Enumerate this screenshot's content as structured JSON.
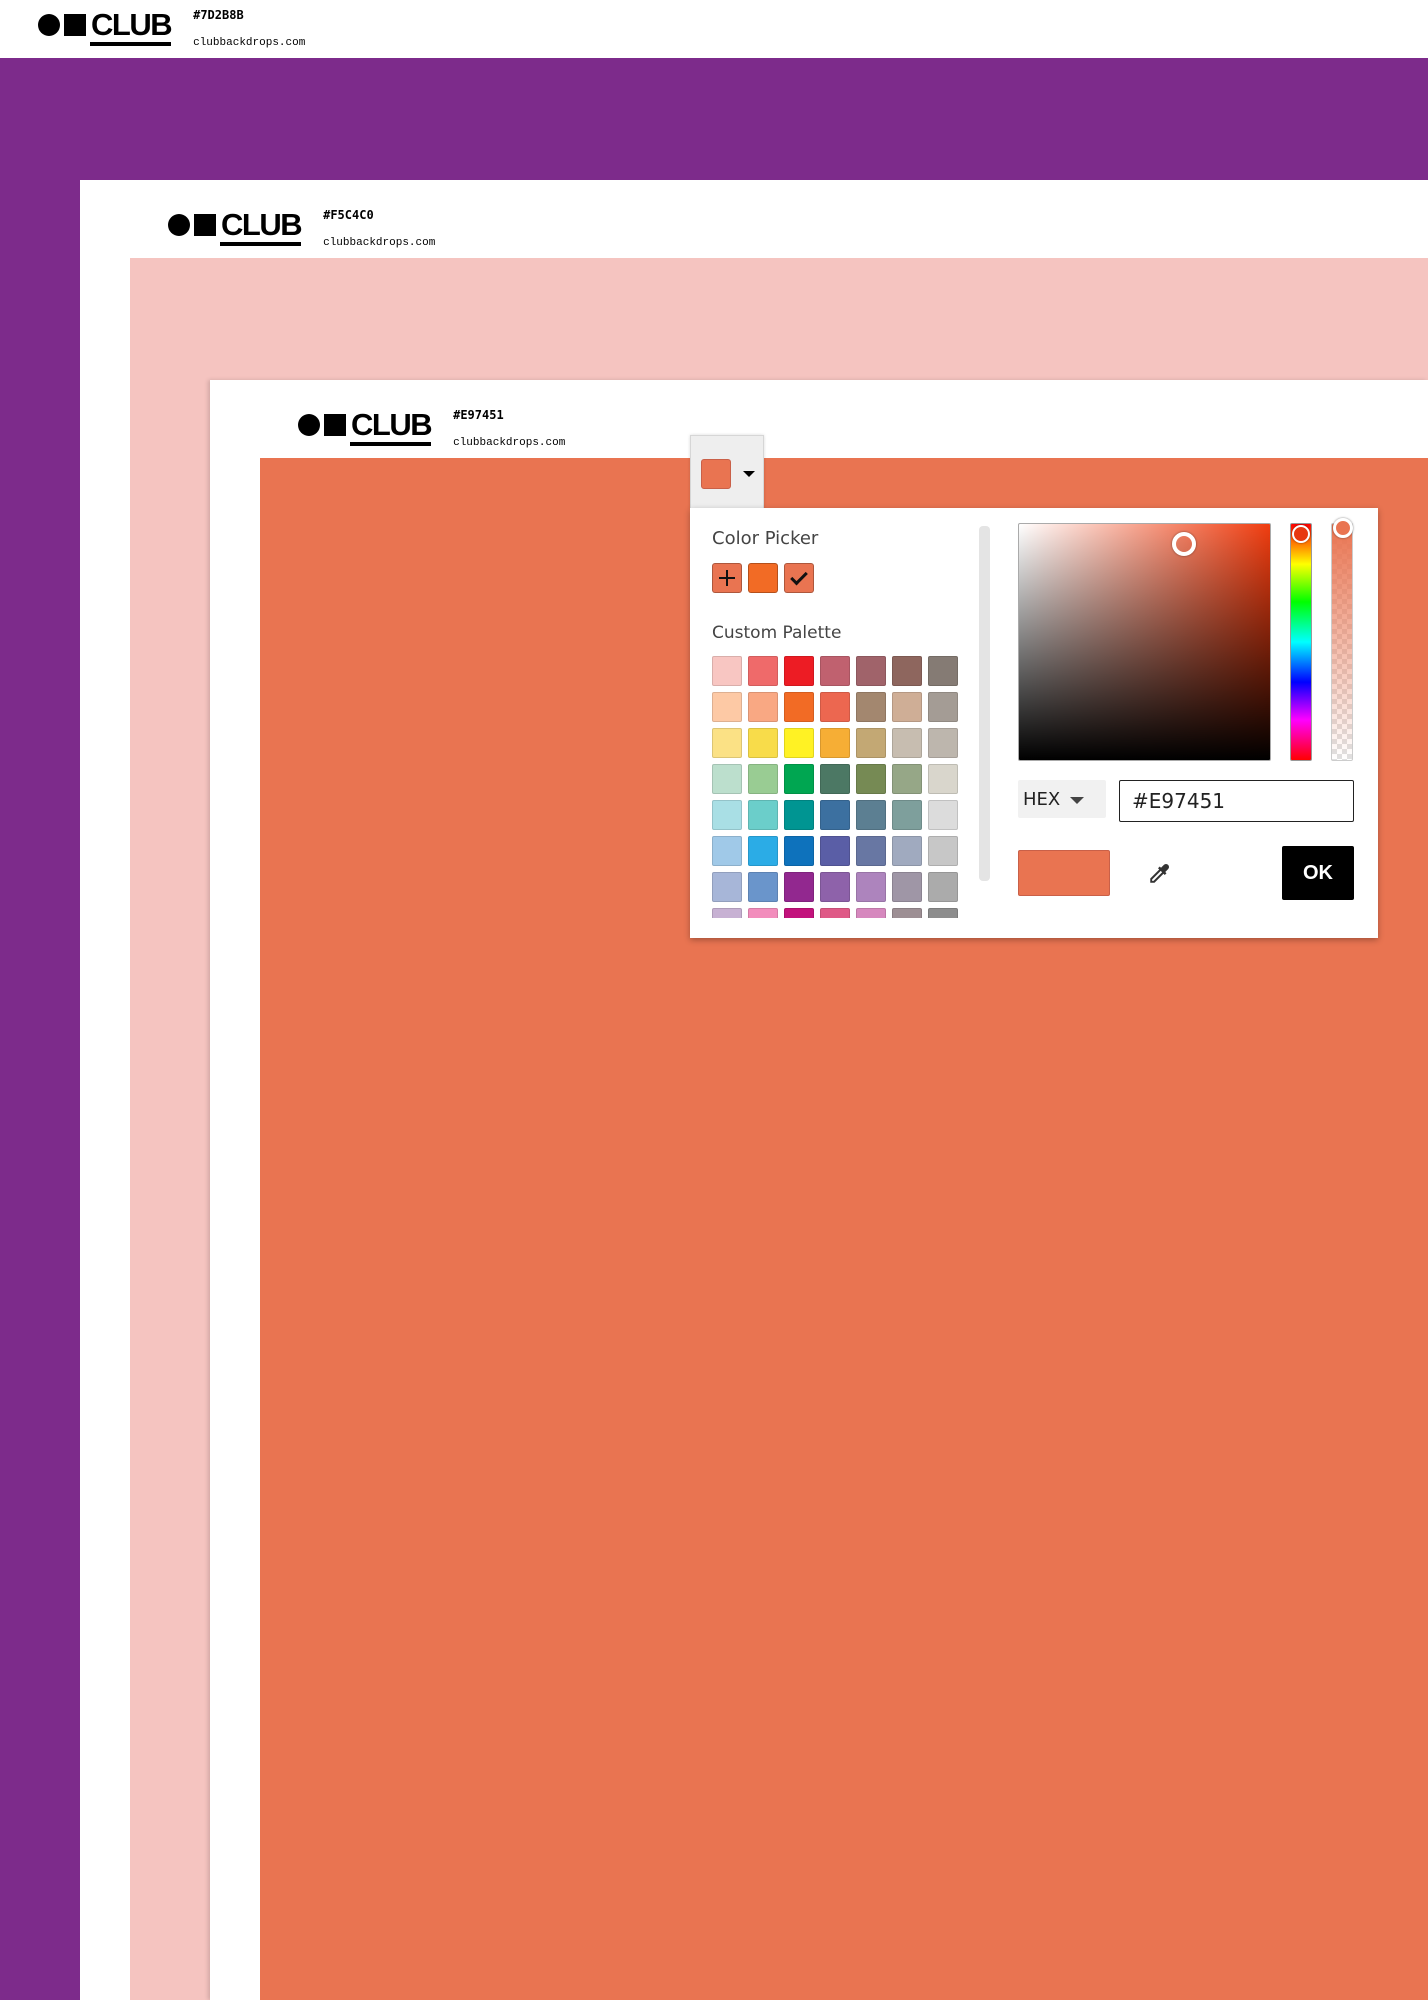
{
  "layers": [
    {
      "hex": "#7D2B8B",
      "url": "clubbackdrops.com",
      "logo": "CLUB"
    },
    {
      "hex": "#F5C4C0",
      "url": "clubbackdrops.com",
      "logo": "CLUB"
    },
    {
      "hex": "#E97451",
      "url": "clubbackdrops.com",
      "logo": "CLUB"
    }
  ],
  "colors": {
    "outer": "#7D2B8B",
    "middle": "#F5C4C0",
    "inner": "#E97451",
    "selected": "#E97451",
    "recent_orange": "#F26B25"
  },
  "picker": {
    "title": "Color Picker",
    "palette_title": "Custom Palette",
    "mode_label": "HEX",
    "hex_value": "#E97451",
    "ok_label": "OK",
    "recent": [
      "add",
      "#F26B25",
      "#E97451"
    ],
    "palette": [
      [
        "#F8C6C2",
        "#EF6A6A",
        "#ED1C24",
        "#C0616F",
        "#A0636A",
        "#8E665E",
        "#857B74"
      ],
      [
        "#FDC9A5",
        "#F9A883",
        "#F26B25",
        "#EC6750",
        "#A3876F",
        "#CFAE96",
        "#A49C95"
      ],
      [
        "#FBE185",
        "#F8DC4A",
        "#FFF224",
        "#F6AE35",
        "#C3A874",
        "#C7BDB0",
        "#BDB6AD"
      ],
      [
        "#BCDFCD",
        "#99CC93",
        "#00A651",
        "#4C7864",
        "#768A54",
        "#96A787",
        "#D9D6CC"
      ],
      [
        "#A9DFE5",
        "#6BCECA",
        "#009592",
        "#3C70A0",
        "#5C7F92",
        "#7E9F9C",
        "#DCDCDC"
      ],
      [
        "#A0C9E8",
        "#2BACE6",
        "#0E72BC",
        "#5A5EA6",
        "#6877A3",
        "#A0AABF",
        "#C7C7C7"
      ],
      [
        "#A7B6D8",
        "#6A95CB",
        "#92288F",
        "#8E62AA",
        "#AD84BD",
        "#9F96A6",
        "#ABABAB"
      ],
      [
        "#C7B1D3",
        "#F28DBC",
        "#C2127C",
        "#DF5A87",
        "#D688BE",
        "#9D8F94",
        "#8D8D8D"
      ]
    ]
  }
}
